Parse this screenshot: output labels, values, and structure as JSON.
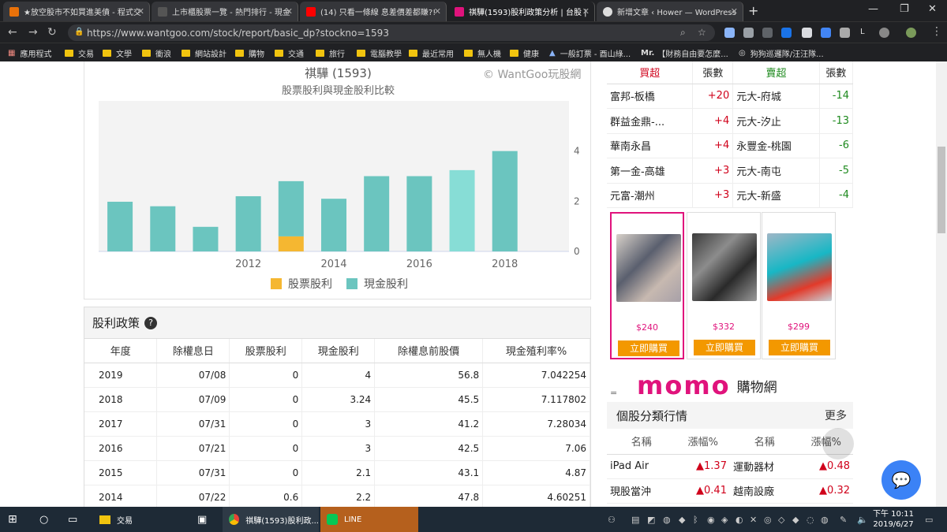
{
  "browser": {
    "tabs": [
      {
        "title": "★放空股市不如買進美債 - 程式交",
        "color": "#e8710a"
      },
      {
        "title": "上市櫃股票一覽 - 熱門排行 - 現金",
        "color": "#444444"
      },
      {
        "title": "(14) 只看一條線 息差價差都賺?!",
        "color": "#ff0000"
      },
      {
        "title": "祺驊(1593)股利政策分析 | 台股 |",
        "color": "#e0137c"
      },
      {
        "title": "新增文章 ‹ Hower — WordPress",
        "color": "#dddddd"
      }
    ],
    "url": "https://www.wantgoo.com/stock/report/basic_dp?stockno=1593",
    "bookmarks": [
      "應用程式",
      "交易",
      "文學",
      "衝浪",
      "網站設計",
      "購物",
      "交通",
      "旅行",
      "電腦教學",
      "最近常用",
      "無人機",
      "健康",
      "一般訂票 - 酉山綠...",
      "【財務自由要怎麼...",
      "狗狗巡邏隊/汪汪隊..."
    ]
  },
  "chart": {
    "title": "祺驊 (1593)",
    "subtitle": "股票股利與現金股利比較",
    "watermark": "© WantGoo玩股網",
    "legend": [
      "股票股利",
      "現金股利"
    ]
  },
  "chart_data": {
    "type": "bar",
    "stacked": true,
    "categories": [
      2009,
      2010,
      2011,
      2012,
      2013,
      2014,
      2015,
      2016,
      2017,
      2018,
      2019
    ],
    "series": [
      {
        "name": "股票股利",
        "values": [
          0,
          0,
          0,
          0,
          0.6,
          0,
          0,
          0,
          0,
          0,
          0
        ],
        "color": "#f5b731"
      },
      {
        "name": "現金股利",
        "values": [
          1.98,
          1.8,
          0.98,
          2.2,
          2.2,
          2.1,
          3,
          3,
          3.24,
          4,
          null
        ],
        "color": "#6bc5bf"
      }
    ],
    "x_tick_labels": [
      "2012",
      "2014",
      "2016",
      "2018"
    ],
    "y_ticks": [
      0,
      2,
      4
    ],
    "ylim": [
      0,
      6
    ],
    "grid": false
  },
  "policy": {
    "title": "股利政策",
    "columns": [
      "年度",
      "除權息日",
      "股票股利",
      "現金股利",
      "除權息前股價",
      "現金殖利率%"
    ],
    "rows": [
      [
        "2019",
        "07/08",
        "0",
        "4",
        "56.8",
        "7.042254"
      ],
      [
        "2018",
        "07/09",
        "0",
        "3.24",
        "45.5",
        "7.117802"
      ],
      [
        "2017",
        "07/31",
        "0",
        "3",
        "41.2",
        "7.28034"
      ],
      [
        "2016",
        "07/21",
        "0",
        "3",
        "42.5",
        "7.06"
      ],
      [
        "2015",
        "07/31",
        "0",
        "2.1",
        "43.1",
        "4.87"
      ],
      [
        "2014",
        "07/22",
        "0.6",
        "2.2",
        "47.8",
        "4.60251"
      ]
    ]
  },
  "broker": {
    "columns": [
      "買超",
      "張數",
      "賣超",
      "張數"
    ],
    "rows": [
      [
        "富邦-板橋",
        "+20",
        "元大-府城",
        "-14"
      ],
      [
        "群益金鼎-...",
        "+4",
        "元大-汐止",
        "-13"
      ],
      [
        "華南永昌",
        "+4",
        "永豐金-桃園",
        "-6"
      ],
      [
        "第一金-高雄",
        "+3",
        "元大-南屯",
        "-5"
      ],
      [
        "元富-潮州",
        "+3",
        "元大-新盛",
        "-4"
      ]
    ]
  },
  "ads": {
    "products": [
      {
        "price": "$240",
        "buy": "立即購買"
      },
      {
        "price": "$332",
        "buy": "立即購買"
      },
      {
        "price": "$299",
        "buy": "立即購買"
      }
    ],
    "logo": "momo",
    "logo_cn": "購物網",
    "tick": "="
  },
  "industry": {
    "title": "個股分類行情",
    "more": "更多",
    "columns": [
      "名稱",
      "漲幅%",
      "名稱",
      "漲幅%"
    ],
    "rows": [
      [
        "iPad Air",
        "▲1.37",
        "運動器材",
        "▲0.48"
      ],
      [
        "現股當沖",
        "▲0.41",
        "越南設廠",
        "▲0.32"
      ]
    ]
  },
  "taskbar": {
    "items": [
      "交易",
      "祺驊(1593)股利政...",
      "LINE"
    ],
    "time": "下午 10:11",
    "date": "2019/6/27"
  }
}
